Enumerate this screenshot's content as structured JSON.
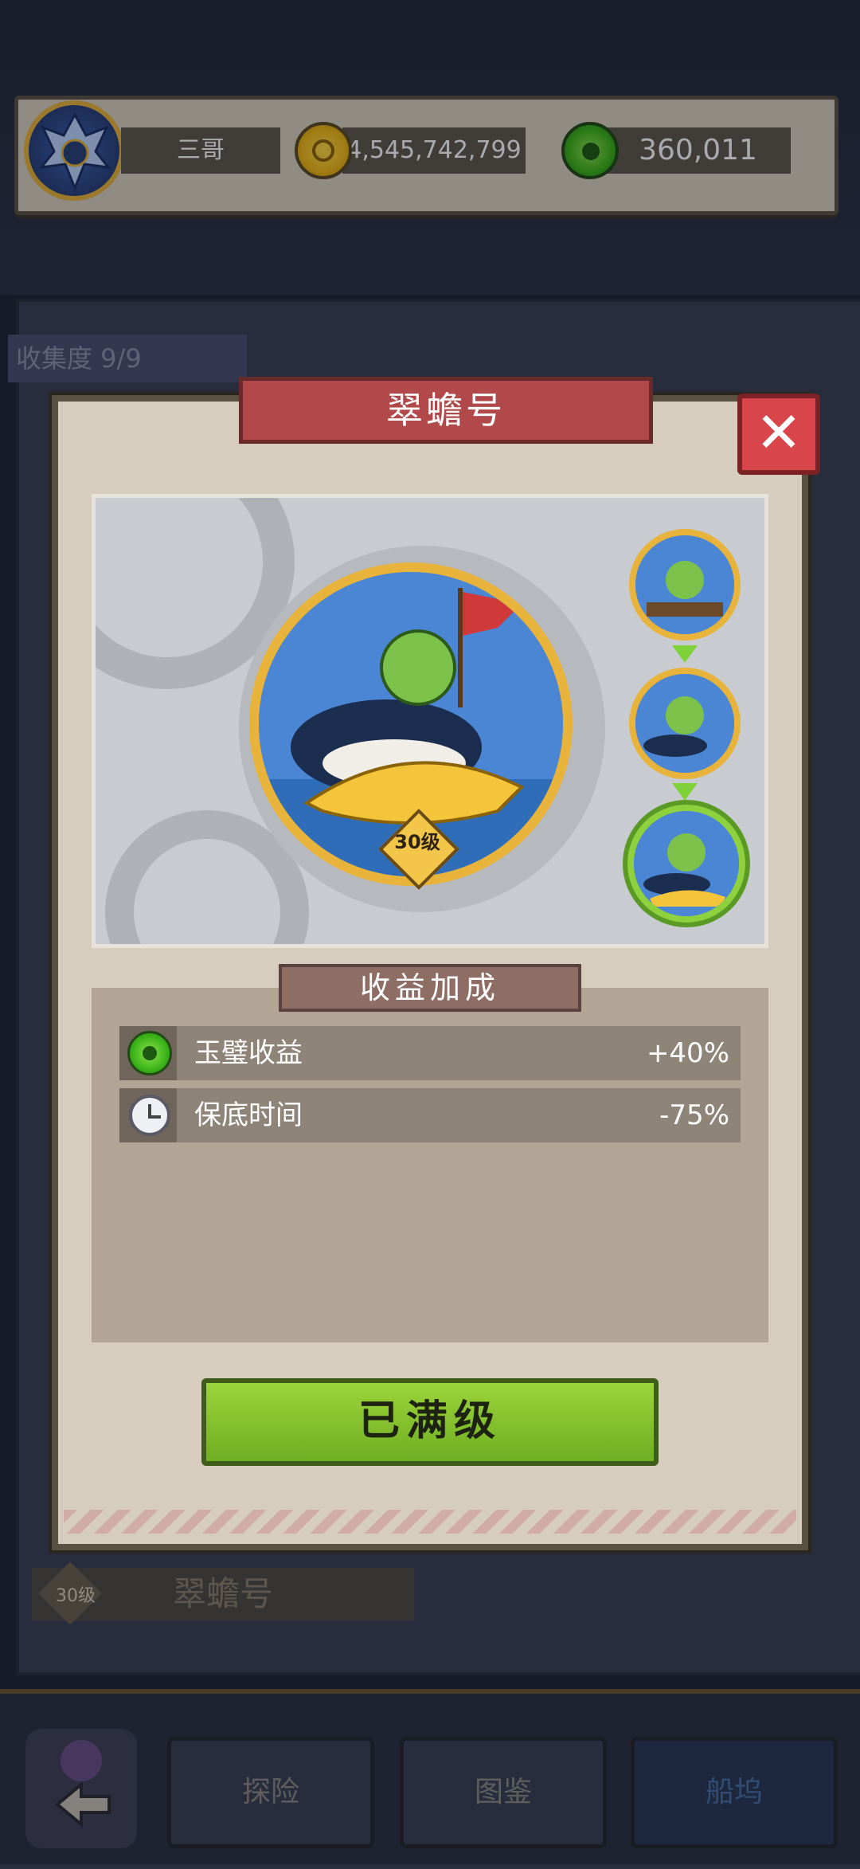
{
  "player": {
    "name": "三哥",
    "coins": "4,545,742,799",
    "jade": "360,011"
  },
  "background": {
    "collection_label": "收集度 9/9",
    "ship_name": "翠蟾号",
    "ship_level": "30级"
  },
  "modal": {
    "title": "翠蟾号",
    "close_icon": "close-icon",
    "level_badge": "30级",
    "bonus_title": "收益加成",
    "bonuses": [
      {
        "icon": "jade-icon",
        "label": "玉璧收益",
        "value": "+40%"
      },
      {
        "icon": "clock-icon",
        "label": "保底时间",
        "value": "-75%"
      }
    ],
    "action_label": "已满级"
  },
  "nav": {
    "explore_label": "探险",
    "codex_label": "图鉴",
    "dock_label": "船坞"
  }
}
